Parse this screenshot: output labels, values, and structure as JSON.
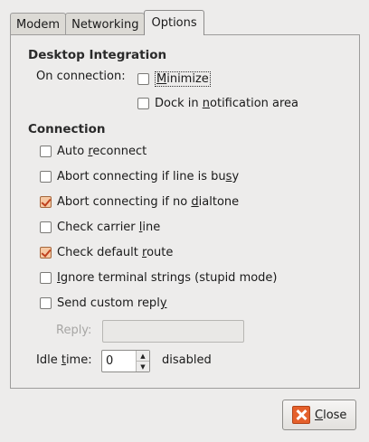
{
  "tabs": [
    {
      "label": "Modem"
    },
    {
      "label": "Networking"
    },
    {
      "label": "Options",
      "active": true
    }
  ],
  "desktop_integration": {
    "title": "Desktop Integration",
    "on_connection_label": "On connection:",
    "minimize": {
      "pre": "",
      "mnemonic": "M",
      "post": "inimize",
      "checked": false
    },
    "dock": {
      "pre": "Dock in ",
      "mnemonic": "n",
      "post": "otification area",
      "checked": false
    }
  },
  "connection": {
    "title": "Connection",
    "options": [
      {
        "pre": "Auto ",
        "mnemonic": "r",
        "post": "econnect",
        "checked": false
      },
      {
        "pre": "Abort connecting if line is bu",
        "mnemonic": "s",
        "post": "y",
        "checked": false
      },
      {
        "pre": "Abort connecting if no ",
        "mnemonic": "d",
        "post": "ialtone",
        "checked": true
      },
      {
        "pre": "Check carrier ",
        "mnemonic": "l",
        "post": "ine",
        "checked": false
      },
      {
        "pre": "Check default ",
        "mnemonic": "r",
        "post": "oute",
        "checked": true
      },
      {
        "pre": "",
        "mnemonic": "I",
        "post": "gnore terminal strings (stupid mode)",
        "checked": false
      },
      {
        "pre": "Send custom repl",
        "mnemonic": "y",
        "post": "",
        "checked": false
      }
    ],
    "reply_label": "Reply:",
    "reply_value": "",
    "idle_label_pre": "Idle ",
    "idle_label_mnemonic": "t",
    "idle_label_post": "ime:",
    "idle_value": "0",
    "idle_status": "disabled"
  },
  "footer": {
    "close_pre": "",
    "close_mnemonic": "C",
    "close_post": "lose"
  },
  "colors": {
    "checked_fill": "#f6c9a4",
    "check_mark": "#c0411e",
    "close_icon": "#e5602b"
  }
}
